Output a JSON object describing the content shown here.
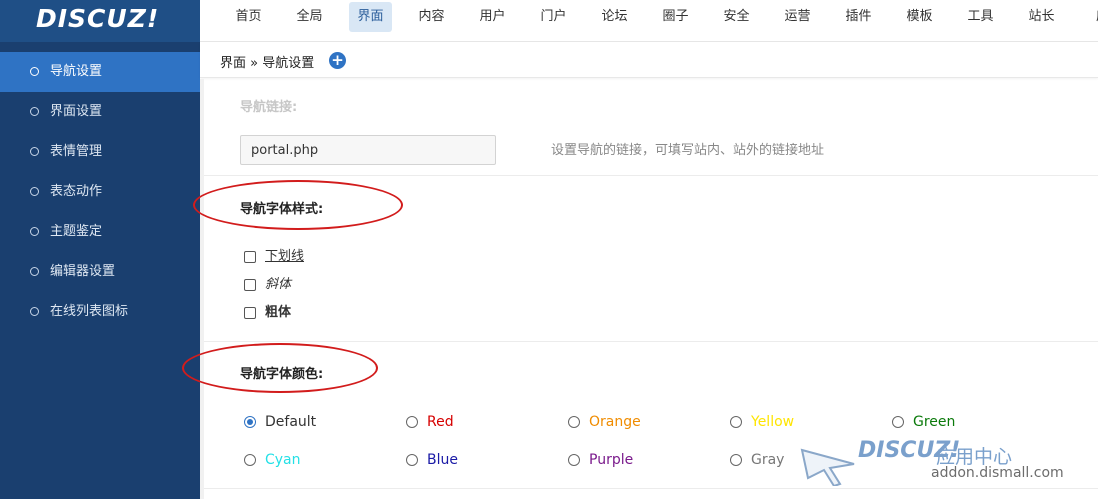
{
  "brand": {
    "logo_text": "DISCUZ!"
  },
  "topnav": {
    "items": [
      {
        "label": "首页"
      },
      {
        "label": "全局"
      },
      {
        "label": "界面"
      },
      {
        "label": "内容"
      },
      {
        "label": "用户"
      },
      {
        "label": "门户"
      },
      {
        "label": "论坛"
      },
      {
        "label": "圈子"
      },
      {
        "label": "安全"
      },
      {
        "label": "运营"
      },
      {
        "label": "插件"
      },
      {
        "label": "模板"
      },
      {
        "label": "工具"
      },
      {
        "label": "站长"
      },
      {
        "label": "应"
      }
    ],
    "active_label": "界面"
  },
  "sidebar": {
    "items": [
      {
        "label": "导航设置"
      },
      {
        "label": "界面设置"
      },
      {
        "label": "表情管理"
      },
      {
        "label": "表态动作"
      },
      {
        "label": "主题鉴定"
      },
      {
        "label": "编辑器设置"
      },
      {
        "label": "在线列表图标"
      }
    ],
    "active_label": "导航设置"
  },
  "breadcrumb": {
    "text": "界面 » 导航设置"
  },
  "form": {
    "link": {
      "label": "导航链接:",
      "value": "portal.php",
      "hint": "设置导航的链接，可填写站内、站外的链接地址"
    },
    "font_style": {
      "label": "导航字体样式:",
      "options": [
        {
          "label": "下划线",
          "checked": false
        },
        {
          "label": "斜体",
          "checked": false
        },
        {
          "label": "粗体",
          "checked": false
        }
      ]
    },
    "font_color": {
      "label": "导航字体颜色:",
      "selected": "Default",
      "options": [
        {
          "label": "Default",
          "color": "#333333"
        },
        {
          "label": "Red",
          "color": "#d60000"
        },
        {
          "label": "Orange",
          "color": "#f08c00"
        },
        {
          "label": "Yellow",
          "color": "#ffe500"
        },
        {
          "label": "Green",
          "color": "#0b7a0b"
        },
        {
          "label": "Cyan",
          "color": "#25e0e6"
        },
        {
          "label": "Blue",
          "color": "#1a1aa6"
        },
        {
          "label": "Purple",
          "color": "#7a1a8c"
        },
        {
          "label": "Gray",
          "color": "#777777"
        }
      ]
    }
  },
  "watermark": {
    "title": "DISCUZ!",
    "subtitle": "应用中心",
    "url": "addon.dismall.com"
  },
  "colors": {
    "sidebar_bg": "#1a3f6f",
    "sidebar_active": "#2f73c4",
    "logo_bg": "#1f4f86",
    "topnav_active_bg": "#d9e7f5",
    "highlight_ellipse": "#d21c1c"
  }
}
